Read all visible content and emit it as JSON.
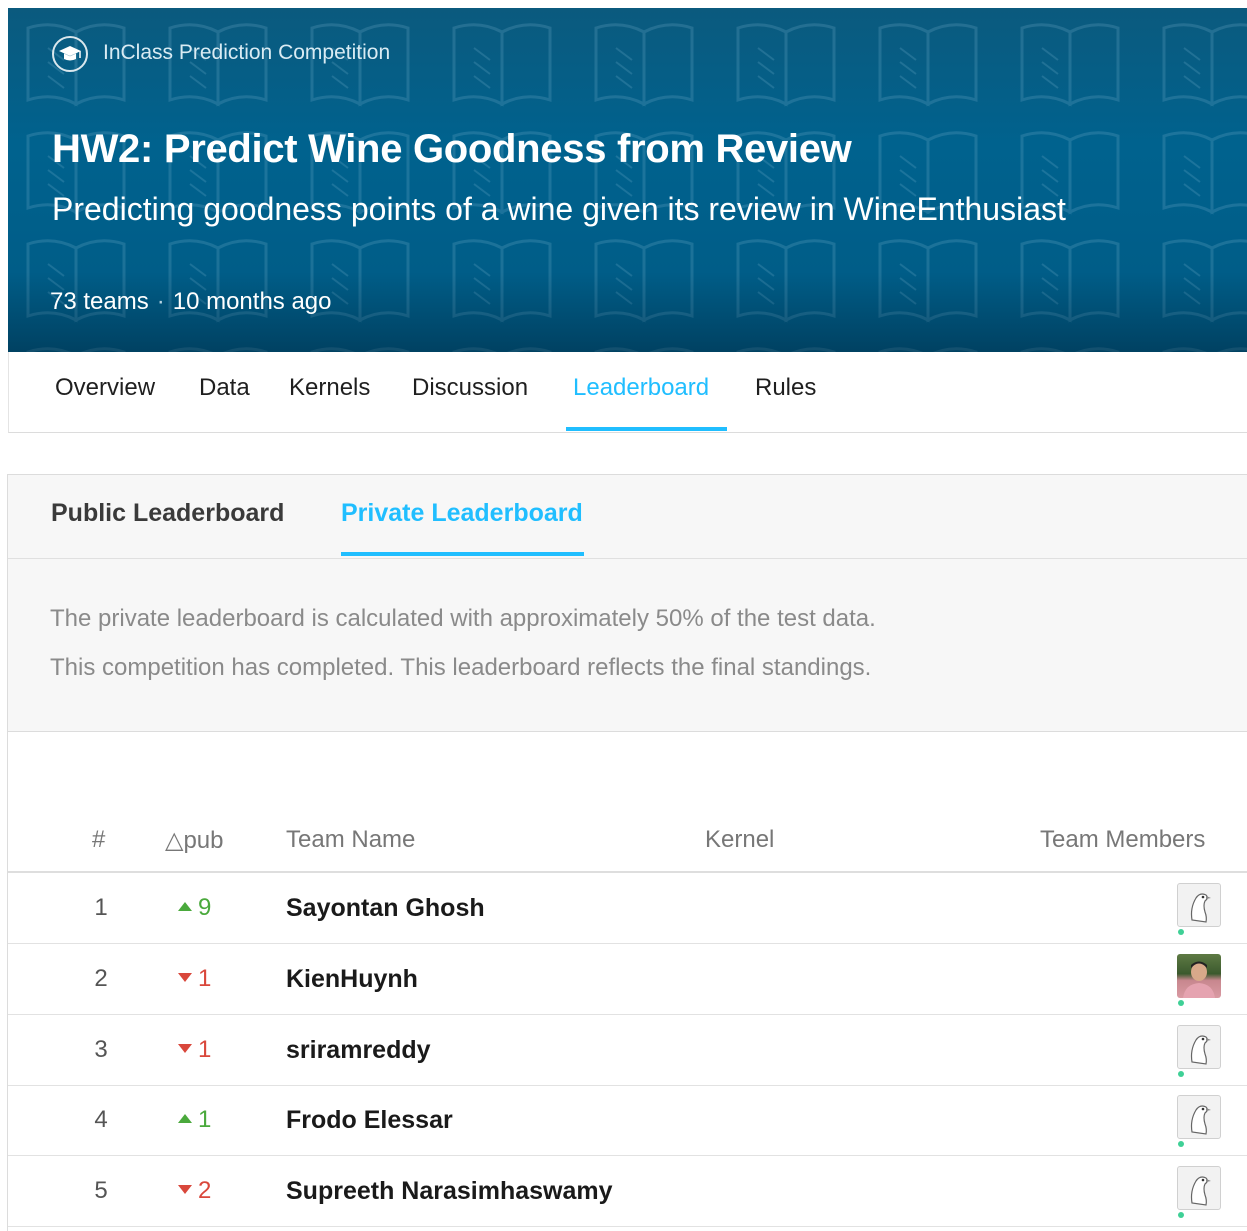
{
  "header": {
    "competition_type": "InClass Prediction Competition",
    "title": "HW2: Predict Wine Goodness from Review",
    "subtitle": "Predicting goodness points of a wine given its review in WineEnthusiast",
    "teams": "73 teams",
    "separator": "·",
    "age": "10 months ago",
    "icon": "graduation-cap-icon",
    "colors": {
      "banner": "#00628e",
      "accent": "#20beff"
    }
  },
  "nav": {
    "tabs": [
      "Overview",
      "Data",
      "Kernels",
      "Discussion",
      "Leaderboard",
      "Rules"
    ],
    "active": "Leaderboard"
  },
  "leaderboard": {
    "tabs": [
      "Public Leaderboard",
      "Private Leaderboard"
    ],
    "active": "Private Leaderboard",
    "notice": [
      "The private leaderboard is calculated with approximately 50% of the test data.",
      "This competition has completed. This leaderboard reflects the final standings."
    ],
    "columns": {
      "rank": "#",
      "delta": "△pub",
      "team": "Team Name",
      "kernel": "Kernel",
      "members": "Team Members"
    },
    "rows": [
      {
        "rank": "1",
        "delta": "9",
        "direction": "up",
        "team": "Sayontan Ghosh",
        "avatar": "default-avatar-icon"
      },
      {
        "rank": "2",
        "delta": "1",
        "direction": "down",
        "team": "KienHuynh",
        "avatar": "user-photo"
      },
      {
        "rank": "3",
        "delta": "1",
        "direction": "down",
        "team": "sriramreddy",
        "avatar": "default-avatar-icon"
      },
      {
        "rank": "4",
        "delta": "1",
        "direction": "up",
        "team": "Frodo Elessar",
        "avatar": "default-avatar-icon"
      },
      {
        "rank": "5",
        "delta": "2",
        "direction": "down",
        "team": "Supreeth Narasimhaswamy",
        "avatar": "default-avatar-icon"
      }
    ]
  }
}
